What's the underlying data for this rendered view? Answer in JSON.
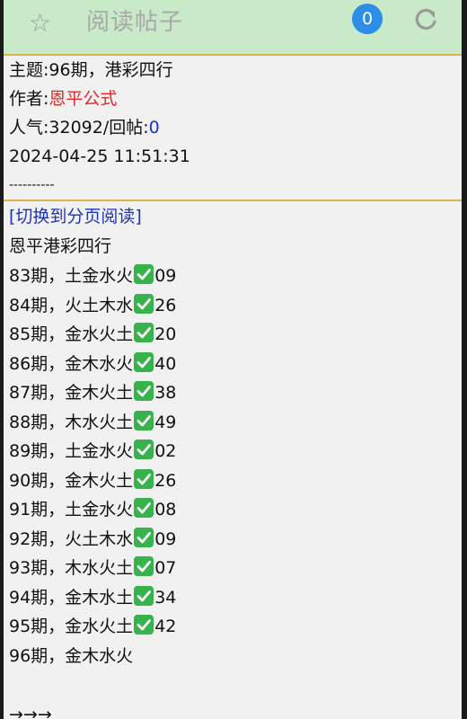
{
  "header": {
    "title": "阅读帖子",
    "badge_count": "0"
  },
  "post": {
    "subject_label": "主题:",
    "subject": "96期，港彩四行",
    "author_label": "作者:",
    "author": "恩平公式",
    "views_label": "人气:",
    "views": "32092",
    "replies_label": "/回帖:",
    "replies": "0",
    "timestamp": "2024-04-25 11:51:31",
    "separator": "----------"
  },
  "content": {
    "switch_link": "[切换到分页阅读]",
    "intro": "恩平港彩四行",
    "entries": [
      {
        "period": "83期，土金水火",
        "result": "09",
        "checked": true
      },
      {
        "period": "84期，火土木水",
        "result": "26",
        "checked": true
      },
      {
        "period": "85期，金水火土",
        "result": "20",
        "checked": true
      },
      {
        "period": "86期，金木水火",
        "result": "40",
        "checked": true
      },
      {
        "period": "87期，金木火土",
        "result": "38",
        "checked": true
      },
      {
        "period": "88期，木水火土",
        "result": "49",
        "checked": true
      },
      {
        "period": "89期，土金水火",
        "result": "02",
        "checked": true
      },
      {
        "period": "90期，金木火土",
        "result": "26",
        "checked": true
      },
      {
        "period": "91期，土金水火",
        "result": "08",
        "checked": true
      },
      {
        "period": "92期，火土木水",
        "result": "09",
        "checked": true
      },
      {
        "period": "93期，木水火土",
        "result": "07",
        "checked": true
      },
      {
        "period": "94期，金木水土",
        "result": "34",
        "checked": true
      },
      {
        "period": "95期，金水火土",
        "result": "42",
        "checked": true
      },
      {
        "period": "96期，金木水火",
        "result": "",
        "checked": false
      }
    ],
    "arrows": "→→→"
  }
}
